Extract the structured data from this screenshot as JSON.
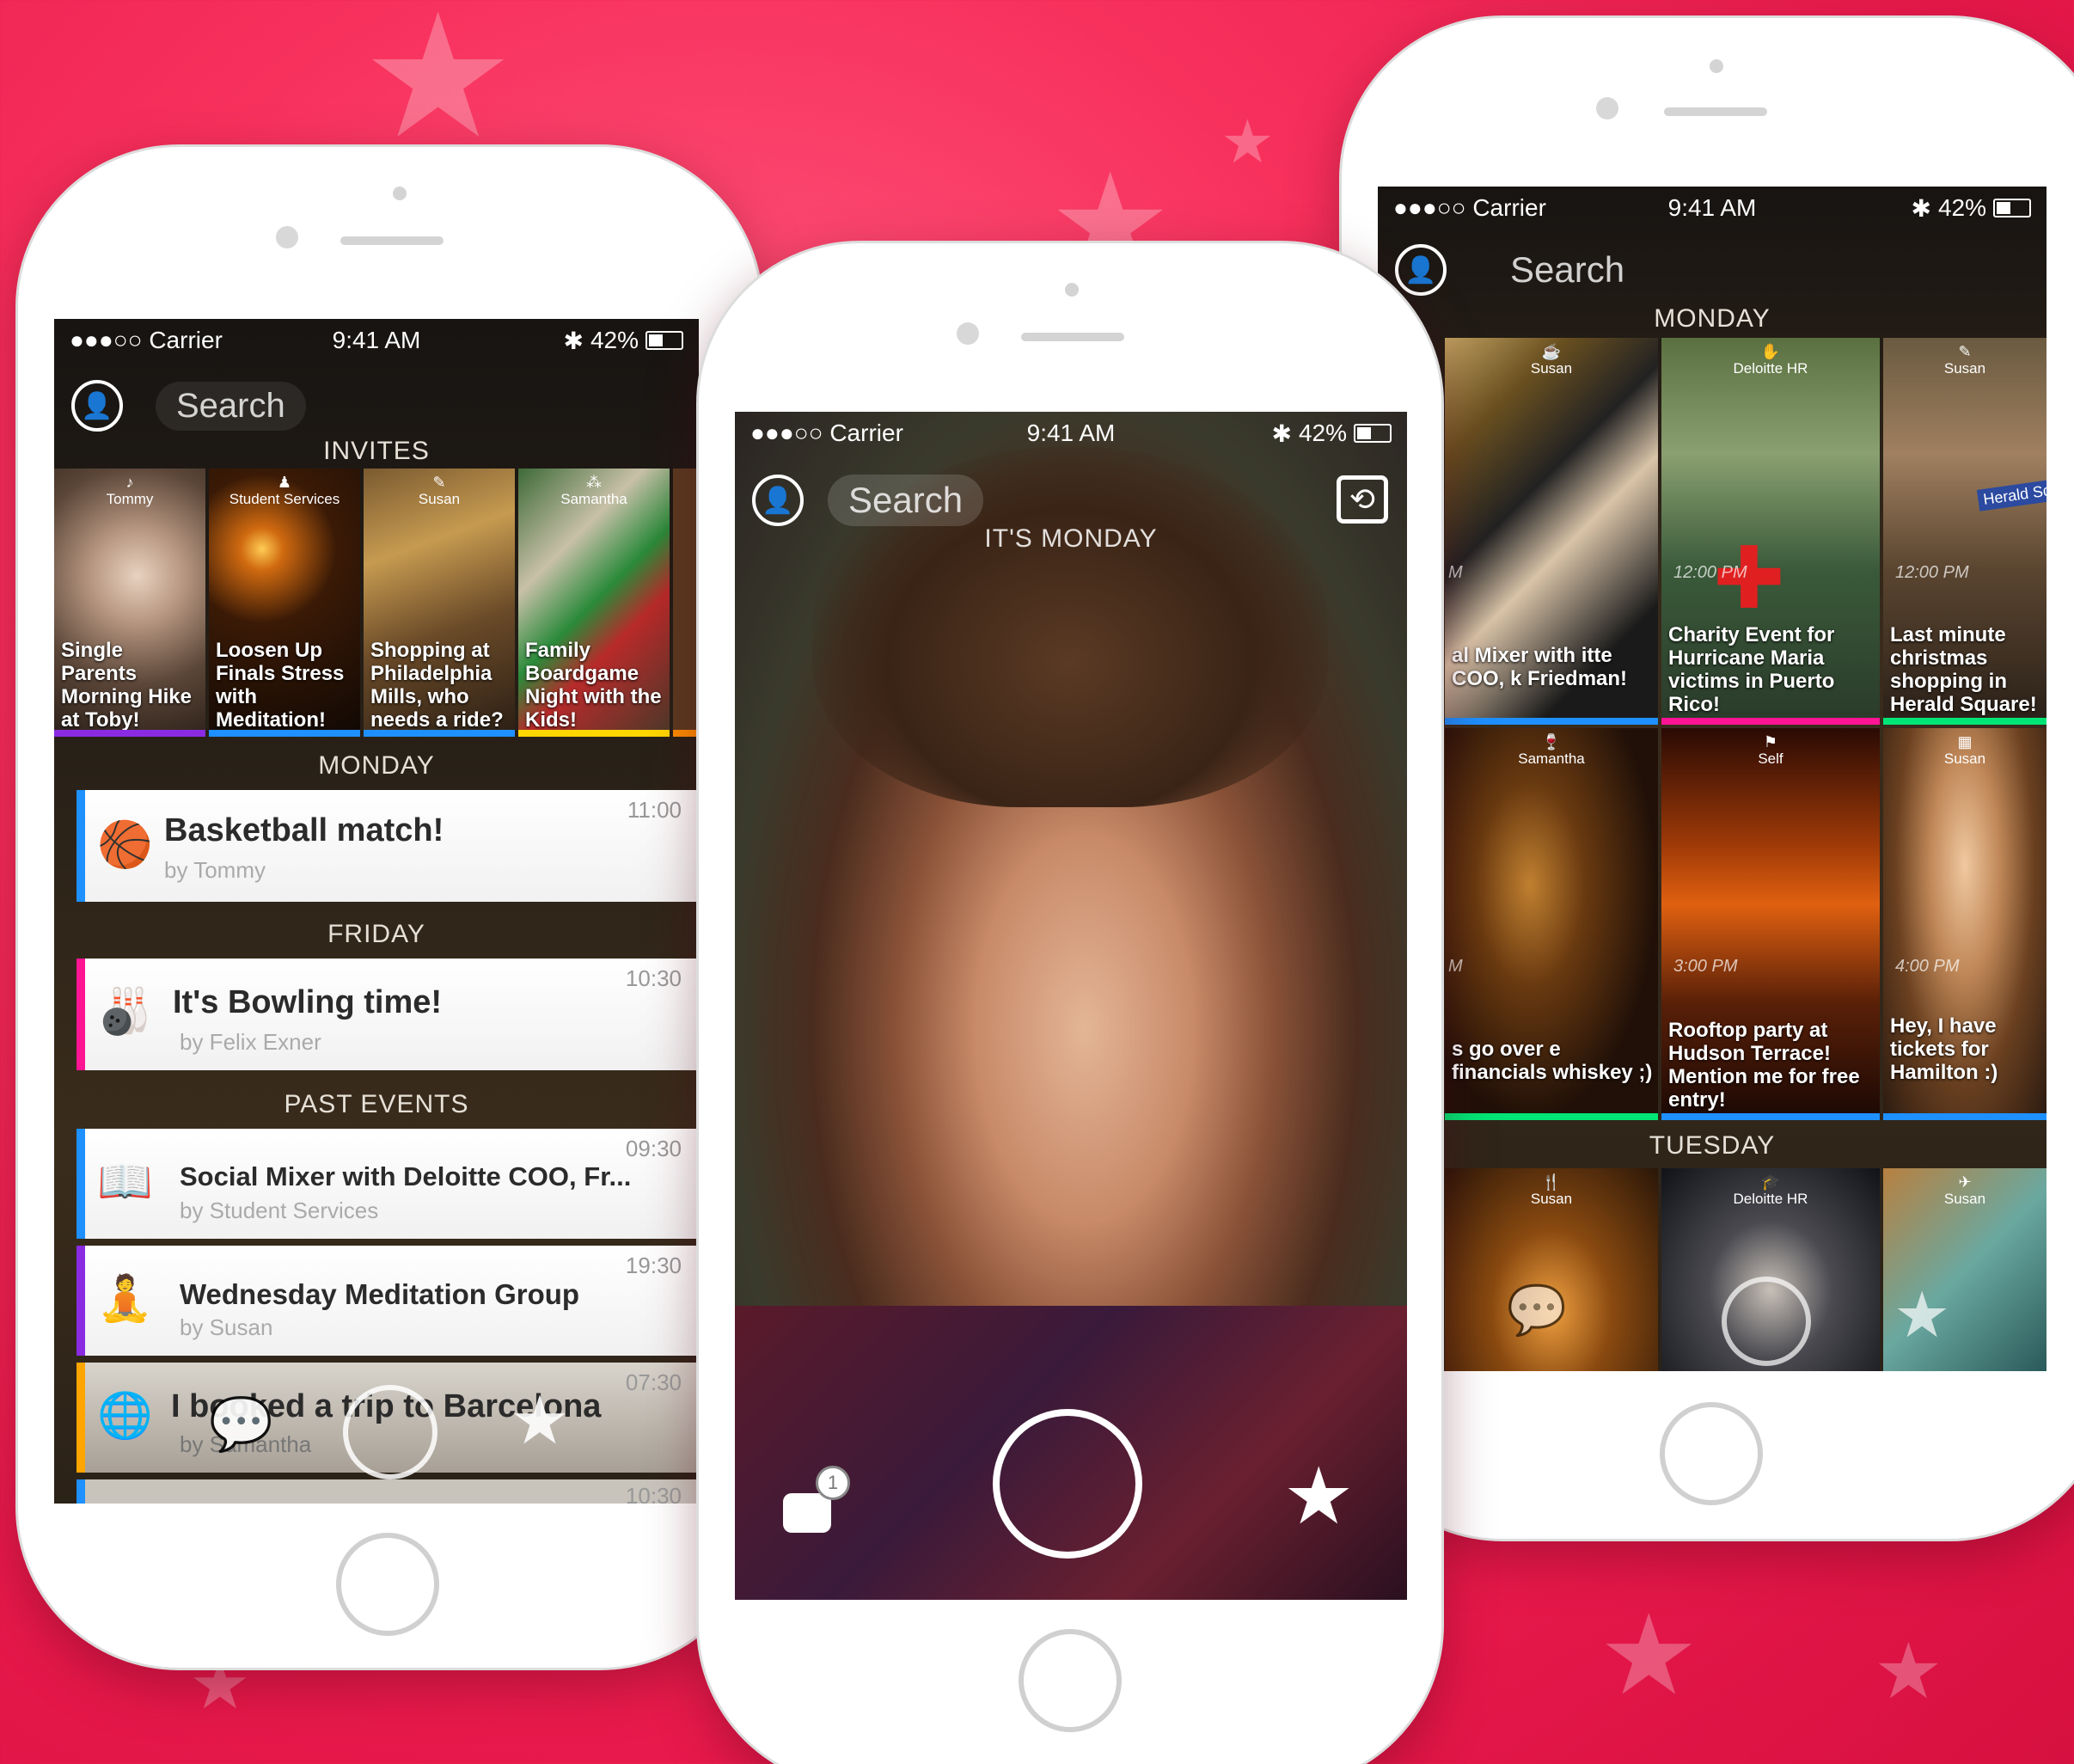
{
  "status": {
    "carrier": "●●●○○ Carrier",
    "time": "9:41 AM",
    "battery": "42%"
  },
  "search": {
    "placeholder": "Search"
  },
  "left_phone": {
    "invites_header": "INVITES",
    "invites": [
      {
        "owner": "Tommy",
        "icon": "music-icon",
        "title": "Single Parents Morning Hike at Toby!",
        "bar": "#8a2be2"
      },
      {
        "owner": "Student Services",
        "icon": "person-icon",
        "title": "Loosen Up Finals Stress with Meditation!",
        "bar": "#1e90ff"
      },
      {
        "owner": "Susan",
        "icon": "tag-icon",
        "title": "Shopping at Philadelphia Mills, who needs a ride?",
        "bar": "#1e90ff"
      },
      {
        "owner": "Samantha",
        "icon": "game-icon",
        "title": "Family Boardgame Night with the Kids!",
        "bar": "#ffd700"
      }
    ],
    "monday_header": "MONDAY",
    "friday_header": "FRIDAY",
    "past_header": "PAST EVENTS",
    "events": [
      {
        "title": "Basketball match!",
        "by": "by Tommy",
        "time": "11:00",
        "icon": "basketball-icon"
      },
      {
        "title": "It's Bowling time!",
        "by": "by Felix Exner",
        "time": "10:30",
        "icon": "bowling-icon"
      },
      {
        "title": "Social Mixer with Deloitte COO, Fr...",
        "by": "by Student Services",
        "time": "09:30",
        "icon": "book-icon"
      },
      {
        "title": "Wednesday Meditation Group",
        "by": "by Susan",
        "time": "19:30",
        "icon": "meditation-icon"
      },
      {
        "title": "I booked a trip to Barcelona",
        "by": "by Samantha",
        "time": "07:30",
        "icon": "passport-icon"
      }
    ],
    "extra_time": "10:30"
  },
  "center_phone": {
    "header": "IT'S MONDAY",
    "notification_count": "1"
  },
  "right_phone": {
    "monday_header": "MONDAY",
    "tuesday_header": "TUESDAY",
    "tiles": [
      {
        "owner": "Susan",
        "time": "M",
        "title": "al Mixer with itte COO, k Friedman!",
        "bar": "#1e90ff"
      },
      {
        "owner": "Deloitte HR",
        "time": "12:00 PM",
        "title": "Charity Event for Hurricane Maria victims in Puerto Rico!",
        "bar": "#ff1493"
      },
      {
        "owner": "Susan",
        "time": "12:00 PM",
        "title": "Last minute christmas shopping in Herald Square!",
        "bar": "#00e676"
      },
      {
        "owner": "Samantha",
        "time": "M",
        "title": "s go over e financials whiskey ;)",
        "bar": "#00e676"
      },
      {
        "owner": "Self",
        "time": "3:00 PM",
        "title": "Rooftop party at Hudson Terrace! Mention me for free entry!",
        "bar": "#1e90ff"
      },
      {
        "owner": "Susan",
        "time": "4:00 PM",
        "title": "Hey, I have tickets for Hamilton :)",
        "bar": "#1e90ff"
      }
    ],
    "tuesday_tiles": [
      {
        "owner": "Susan"
      },
      {
        "owner": "Deloitte HR"
      },
      {
        "owner": "Susan"
      }
    ],
    "sign_text": "Herald Square"
  }
}
